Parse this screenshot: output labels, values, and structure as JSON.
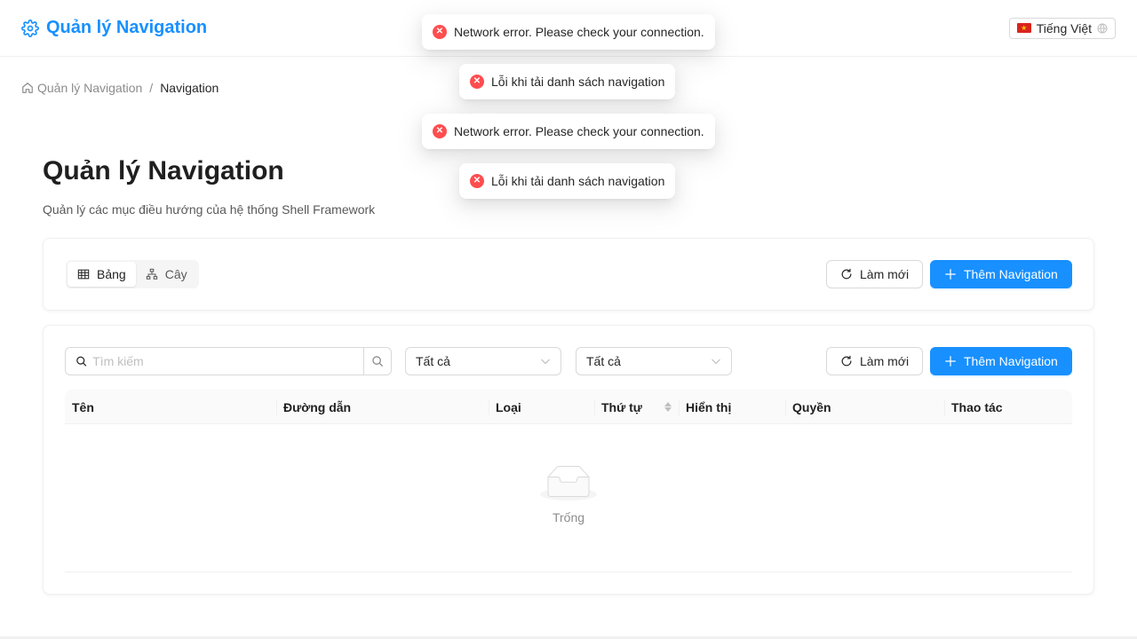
{
  "header": {
    "title": "Quản lý Navigation",
    "language": "Tiếng Việt"
  },
  "breadcrumb": {
    "parent": "Quản lý Navigation",
    "separator": "/",
    "current": "Navigation"
  },
  "page": {
    "title": "Quản lý Navigation",
    "subtitle": "Quản lý các mục điều hướng của hệ thống Shell Framework"
  },
  "view_toggle": {
    "table_label": "Bảng",
    "tree_label": "Cây",
    "selected": "Bảng"
  },
  "toolbar": {
    "refresh_label": "Làm mới",
    "add_label": "Thêm Navigation"
  },
  "filters": {
    "search_placeholder": "Tìm kiếm",
    "select1_value": "Tất cả",
    "select2_value": "Tất cả"
  },
  "table": {
    "columns": [
      "Tên",
      "Đường dẫn",
      "Loại",
      "Thứ tự",
      "Hiển thị",
      "Quyền",
      "Thao tác"
    ],
    "empty_text": "Trống"
  },
  "toasts": [
    "Network error. Please check your connection.",
    "Lỗi khi tải danh sách navigation",
    "Network error. Please check your connection.",
    "Lỗi khi tải danh sách navigation"
  ],
  "colors": {
    "primary": "#1890ff",
    "error": "#ff4d4f"
  }
}
